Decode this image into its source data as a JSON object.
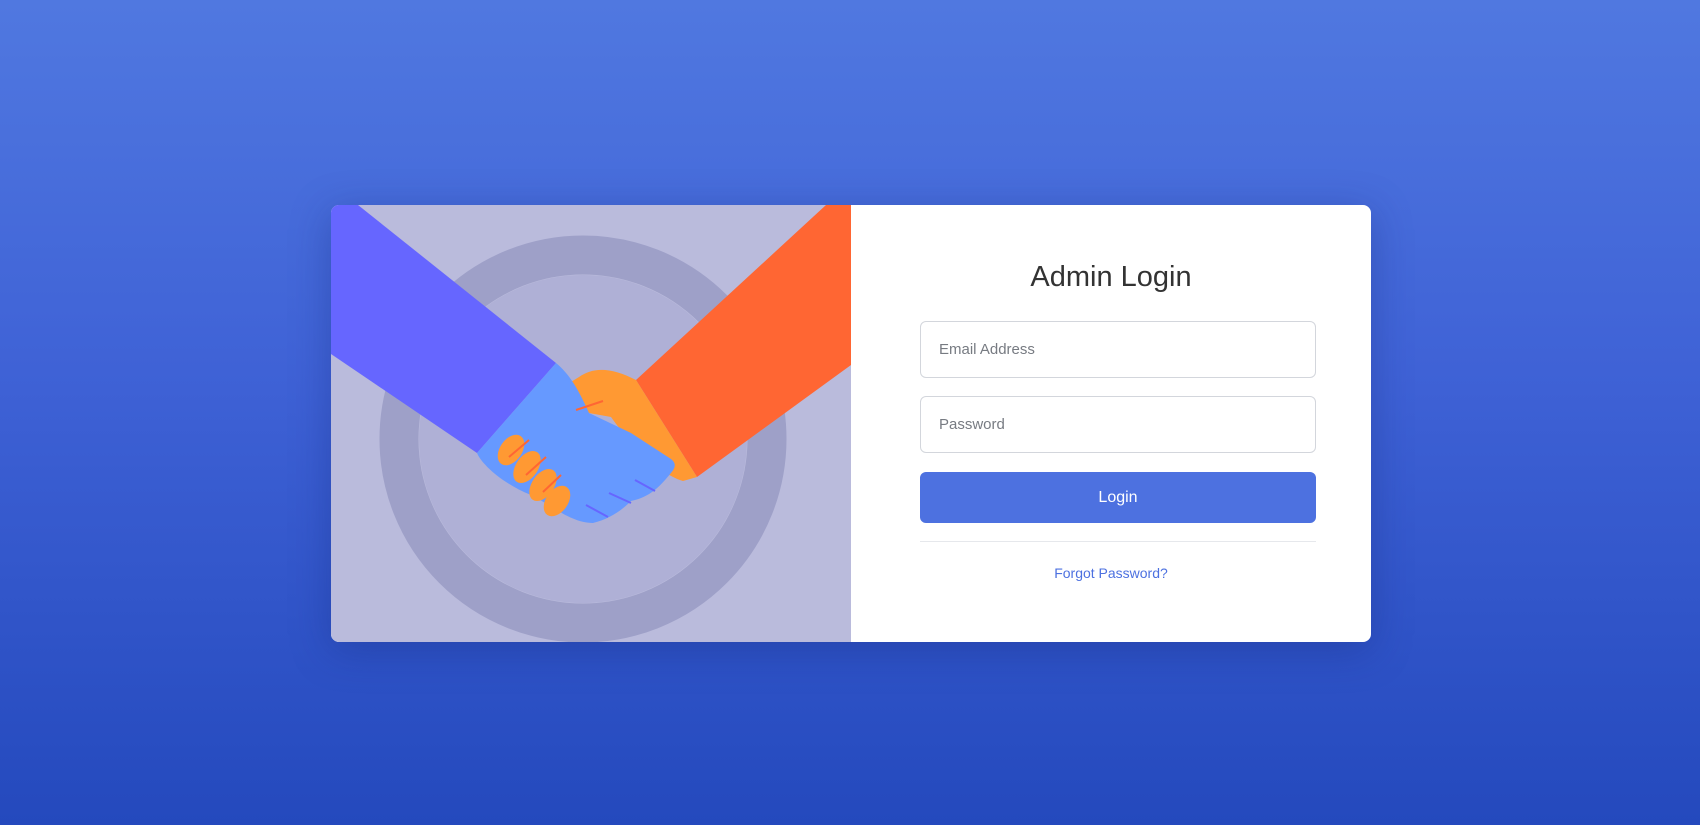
{
  "colors": {
    "background_top": "#5078e0",
    "background_bottom": "#2449bd",
    "illustration_bg": "#babbdc",
    "accent": "#4d71e0",
    "left_sleeve": "#6666ff",
    "left_hand": "#6699ff",
    "right_sleeve": "#ff6633",
    "right_hand": "#ff9933"
  },
  "illustration": {
    "icon": "handshake-icon"
  },
  "login": {
    "title": "Admin Login",
    "email_placeholder": "Email Address",
    "email_value": "",
    "password_placeholder": "Password",
    "password_value": "",
    "submit_label": "Login",
    "forgot_label": "Forgot Password?"
  }
}
